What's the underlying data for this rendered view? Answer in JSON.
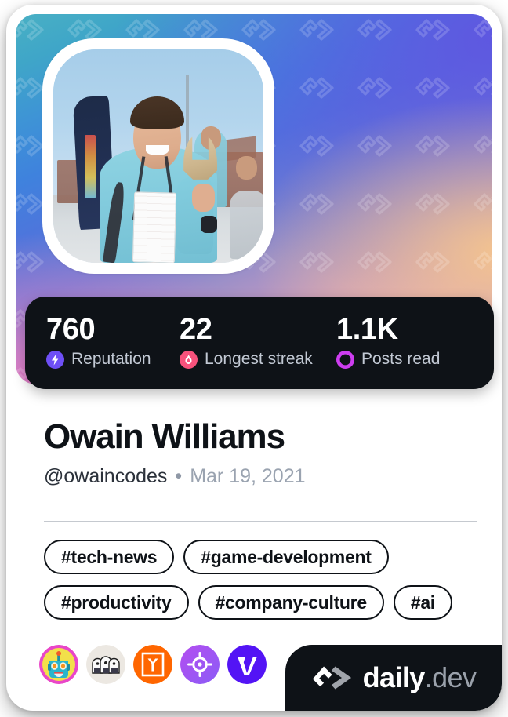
{
  "card": {
    "accent_gradient_start": "#49b0c4",
    "accent_gradient_end": "#8a7fe0",
    "surface_dark": "#0e1217"
  },
  "banner": {
    "watermark_icon": "daily-dev-logo-watermark",
    "avatar_icon": "user-avatar-photo",
    "avatar_alt": "Owain Williams smiling at an outdoor tech event holding a wooden award"
  },
  "stats": {
    "items": [
      {
        "value": "760",
        "label": "Reputation",
        "icon": "reputation-bolt-icon",
        "color": "#6e4ff6"
      },
      {
        "value": "22",
        "label": "Longest streak",
        "icon": "streak-flame-icon",
        "color": "#f8527c"
      },
      {
        "value": "1.1K",
        "label": "Posts read",
        "icon": "posts-read-ring-icon",
        "color": "#cd3df0"
      }
    ]
  },
  "profile": {
    "name": "Owain Williams",
    "handle": "@owaincodes",
    "separator": "•",
    "date": "Mar 19, 2021"
  },
  "tags": {
    "items": [
      "#tech-news",
      "#game-development",
      "#productivity",
      "#company-culture",
      "#ai"
    ]
  },
  "sources": {
    "items": [
      {
        "icon": "robot-avatar-source-icon",
        "color": "#2fc2d8"
      },
      {
        "icon": "three-ghosts-source-icon",
        "color": "#ede9e3"
      },
      {
        "icon": "hacker-news-source-icon",
        "color": "#ff6600"
      },
      {
        "icon": "crosshair-target-source-icon",
        "color": "#a855f7"
      },
      {
        "icon": "v-letter-source-icon",
        "color": "#5314f5"
      }
    ]
  },
  "brand": {
    "mark_icon": "daily-dev-chevron-logo-icon",
    "name": "daily",
    "tld": ".dev"
  }
}
